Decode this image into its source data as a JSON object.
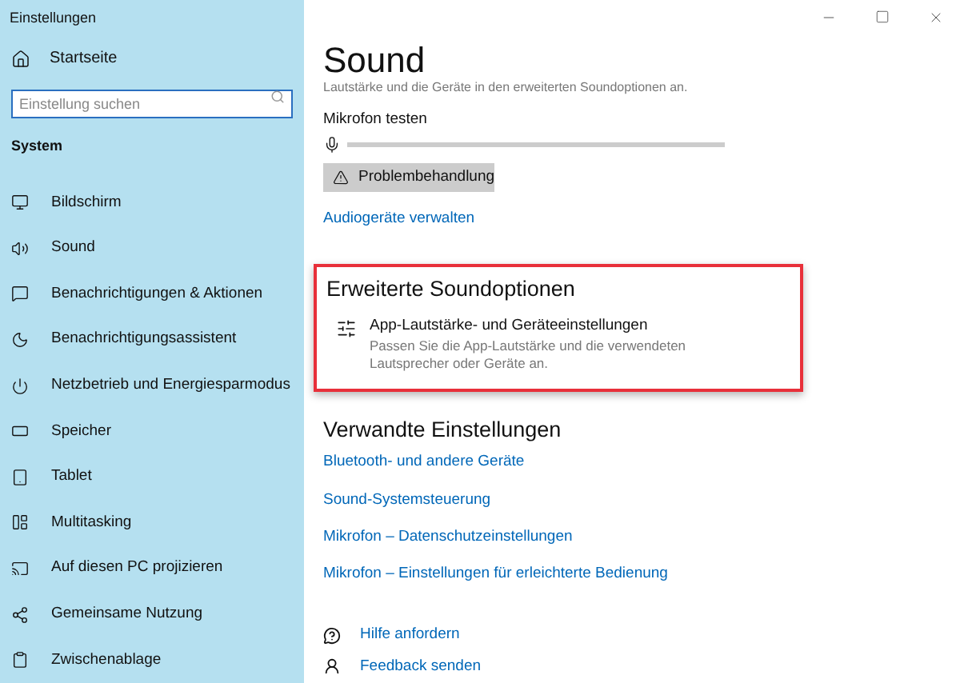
{
  "window": {
    "title": "Einstellungen"
  },
  "sidebar": {
    "home": "Startseite",
    "search": {
      "placeholder": "Einstellung suchen"
    },
    "section": "System",
    "items": [
      {
        "label": "Bildschirm",
        "selected": false
      },
      {
        "label": "Sound",
        "selected": false
      },
      {
        "label": "Benachrichtigungen & Aktionen",
        "selected": false
      },
      {
        "label": "Benachrichtigungsassistent",
        "selected": false
      },
      {
        "label": "Netzbetrieb und Energiesparmodus",
        "selected": false
      },
      {
        "label": "Speicher",
        "selected": false
      },
      {
        "label": "Tablet",
        "selected": false
      },
      {
        "label": "Multitasking",
        "selected": false
      },
      {
        "label": "Auf diesen PC projizieren",
        "selected": false
      },
      {
        "label": "Gemeinsame Nutzung",
        "selected": false
      },
      {
        "label": "Zwischenablage",
        "selected": false
      }
    ]
  },
  "page": {
    "title": "Sound",
    "intro": "Lautstärke und die Geräte in den erweiterten Soundoptionen an.",
    "mic_test": {
      "label": "Mikrofon testen"
    },
    "troubleshoot_button": "Problembehandlung",
    "manage_link": "Audiogeräte verwalten",
    "advanced": {
      "title": "Erweiterte Soundoptionen",
      "highlighted": true,
      "item_title": "App-Lautstärke- und Geräteeinstellungen",
      "item_description": "Passen Sie die App-Lautstärke und die verwendeten Lautsprecher oder Geräte an."
    },
    "related": {
      "title": "Verwandte Einstellungen",
      "links": [
        "Bluetooth- und andere Geräte",
        "Sound-Systemsteuerung",
        "Mikrofon – Datenschutzeinstellungen",
        "Mikrofon – Einstellungen für erleichterte Bedienung"
      ]
    },
    "help": [
      "Hilfe anfordern",
      "Feedback senden"
    ]
  }
}
